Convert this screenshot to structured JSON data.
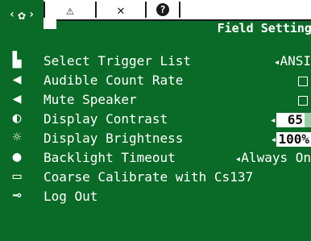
{
  "tabs": [
    {
      "name": "settings",
      "icon": "gear-icon",
      "glyph": "✿",
      "active": true,
      "arrow_left": "‹",
      "arrow_right": "›"
    },
    {
      "name": "alarms",
      "icon": "alarm-icon",
      "glyph": "⚠"
    },
    {
      "name": "tools",
      "icon": "tools-icon",
      "glyph": "✕"
    },
    {
      "name": "help",
      "icon": "help-icon",
      "glyph": "?"
    }
  ],
  "header": {
    "title": "Field Settings"
  },
  "side_icons": [
    {
      "name": "trigger-list-icon",
      "glyph": "▙"
    },
    {
      "name": "speaker-icon",
      "glyph": "◀"
    },
    {
      "name": "mute-icon",
      "glyph": "◀"
    },
    {
      "name": "contrast-icon",
      "glyph": "◐"
    },
    {
      "name": "brightness-icon",
      "glyph": "☼"
    },
    {
      "name": "backlight-icon",
      "glyph": "●"
    },
    {
      "name": "calibrate-icon",
      "glyph": "▭"
    },
    {
      "name": "logout-key-icon",
      "glyph": "⊸"
    }
  ],
  "menu": {
    "items": [
      {
        "label": "Select Trigger List",
        "value": "ANSI"
      },
      {
        "label": "Audible Count Rate",
        "checked": false
      },
      {
        "label": "Mute Speaker",
        "checked": false
      },
      {
        "label": "Display Contrast",
        "value": "65",
        "level_percent": 65
      },
      {
        "label": "Display Brightness",
        "value": "100%",
        "level_percent": 100
      },
      {
        "label": "Backlight Timeout",
        "value": "Always On"
      },
      {
        "label": "Coarse Calibrate with Cs137"
      },
      {
        "label": "Log Out"
      }
    ]
  }
}
